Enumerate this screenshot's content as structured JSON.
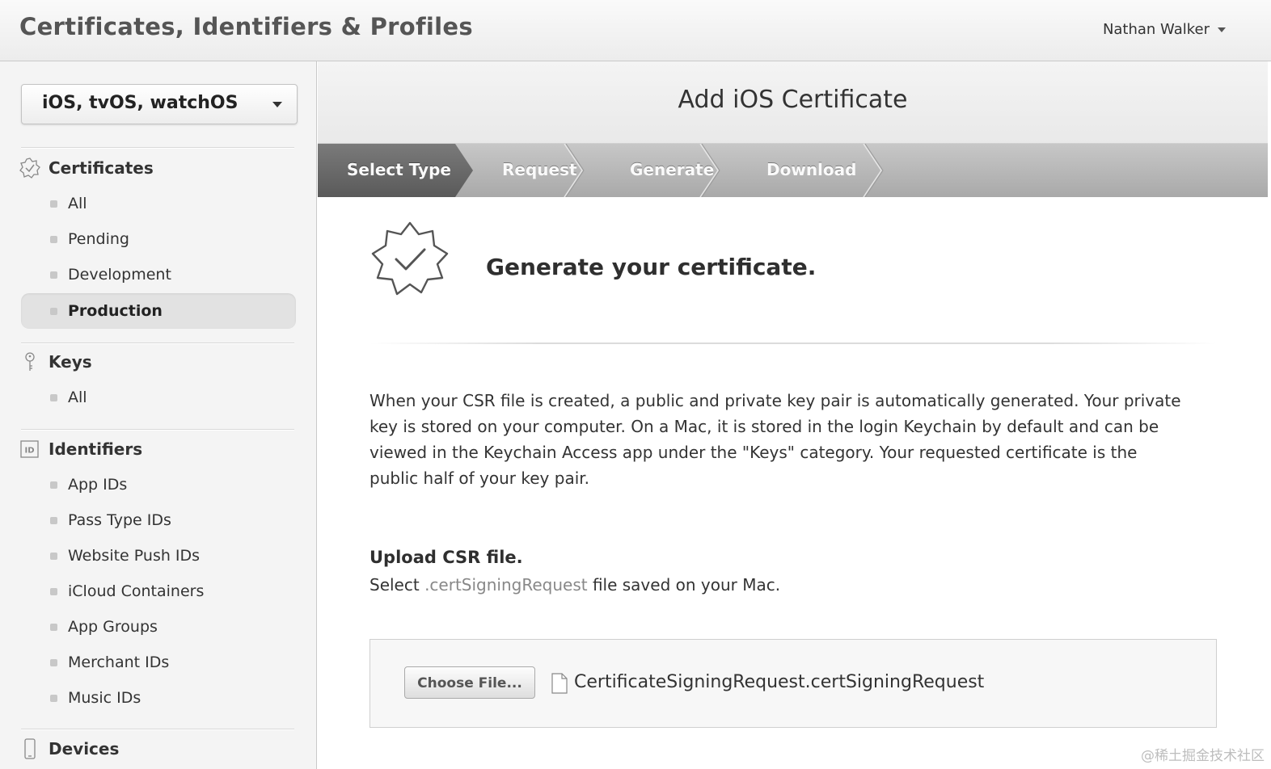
{
  "header": {
    "title": "Certificates, Identifiers & Profiles",
    "user_name": "Nathan Walker"
  },
  "sidebar": {
    "platform_select": "iOS, tvOS, watchOS",
    "sections": [
      {
        "title": "Certificates",
        "icon": "certificate-badge-icon",
        "items": [
          "All",
          "Pending",
          "Development",
          "Production"
        ],
        "active": "Production"
      },
      {
        "title": "Keys",
        "icon": "key-icon",
        "items": [
          "All"
        ]
      },
      {
        "title": "Identifiers",
        "icon": "id-icon",
        "items": [
          "App IDs",
          "Pass Type IDs",
          "Website Push IDs",
          "iCloud Containers",
          "App Groups",
          "Merchant IDs",
          "Music IDs"
        ]
      },
      {
        "title": "Devices",
        "icon": "device-icon",
        "items": []
      }
    ]
  },
  "main": {
    "page_title": "Add iOS Certificate",
    "steps": [
      "Select Type",
      "Request",
      "Generate",
      "Download"
    ],
    "active_step": "Select Type",
    "generate_title": "Generate your certificate.",
    "description": "When your CSR file is created, a public and private key pair is automatically generated. Your private key is stored on your computer. On a Mac, it is stored in the login Keychain by default and can be viewed in the Keychain Access app under the \"Keys\" category. Your requested certificate is the public half of your key pair.",
    "upload_title": "Upload CSR file.",
    "upload_hint_prefix": "Select",
    "upload_hint_ext": ".certSigningRequest",
    "upload_hint_suffix": "file saved on your Mac.",
    "choose_button": "Choose File...",
    "file_name": "CertificateSigningRequest.certSigningRequest"
  },
  "watermark": "@稀土掘金技术社区",
  "colors": {
    "header_bg": "#ececec",
    "sidebar_bg": "#f4f4f4",
    "step_active": "#666666",
    "step_inactive": "#b8b8b8"
  }
}
